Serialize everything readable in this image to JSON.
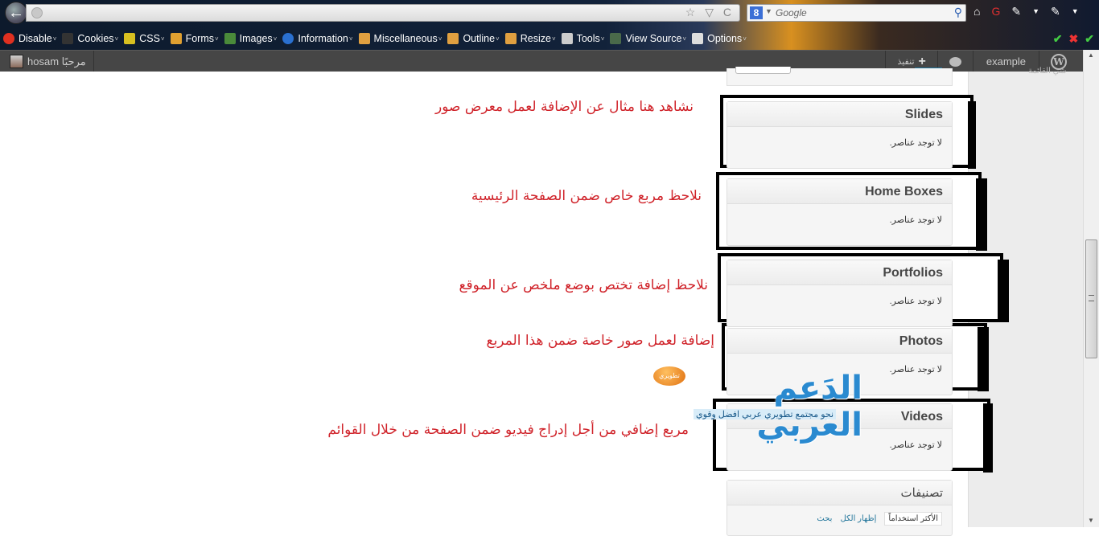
{
  "browser": {
    "back_label": "←",
    "search_engine_icon": "8",
    "search_placeholder": "Google",
    "url_controls": "☆ ▽ C",
    "nav_icons": [
      "home-icon",
      "addon-icon",
      "tools-icon",
      "dropdown-icon",
      "extension-icon",
      "dropdown-icon"
    ]
  },
  "devtoolbar": {
    "items": [
      {
        "label": "Disable",
        "icon": "disable-icon",
        "color": "#e03020"
      },
      {
        "label": "Cookies",
        "icon": "cookies-icon",
        "color": "#333333"
      },
      {
        "label": "CSS",
        "icon": "css-icon",
        "color": "#d8c020"
      },
      {
        "label": "Forms",
        "icon": "forms-icon",
        "color": "#e0a030"
      },
      {
        "label": "Images",
        "icon": "images-icon",
        "color": "#4a8a3a"
      },
      {
        "label": "Information",
        "icon": "information-icon",
        "color": "#2a70d0"
      },
      {
        "label": "Miscellaneous",
        "icon": "miscellaneous-icon",
        "color": "#e0a040"
      },
      {
        "label": "Outline",
        "icon": "outline-icon",
        "color": "#e0a040"
      },
      {
        "label": "Resize",
        "icon": "resize-icon",
        "color": "#e0a040"
      },
      {
        "label": "Tools",
        "icon": "tools-icon",
        "color": "#cccccc"
      },
      {
        "label": "View Source",
        "icon": "view-source-icon",
        "color": "#4a6a4a"
      },
      {
        "label": "Options",
        "icon": "options-icon",
        "color": "#dddddd"
      }
    ],
    "status": [
      "✔",
      "✖",
      "✔"
    ]
  },
  "adminbar": {
    "greeting": "مرحبًا",
    "username": "hosam",
    "new_label": "تنفيذ",
    "site_name": "example"
  },
  "sidebar": {
    "link": "شي القائمة"
  },
  "boxes": [
    {
      "title": "Slides",
      "empty": "لا توجد عناصر."
    },
    {
      "title": "Home Boxes",
      "empty": "لا توجد عناصر."
    },
    {
      "title": "Portfolios",
      "empty": "لا توجد عناصر."
    },
    {
      "title": "Photos",
      "empty": "لا توجد عناصر."
    },
    {
      "title": "Videos",
      "empty": "لا توجد عناصر."
    }
  ],
  "annotations": [
    "نشاهد هنا مثال عن الإضافة لعمل معرض صور",
    "نلاحظ مربع خاص ضمن الصفحة الرئيسية",
    "نلاحظ إضافة تختص بوضع ملخص عن الموقع",
    "إضافة لعمل صور خاصة ضمن هذا المربع",
    "مربع إضافي من أجل إدراج فيديو ضمن الصفحة من خلال القوائم"
  ],
  "categories": {
    "title": "تصنيفات",
    "tabs": [
      "الأكثر استخداماً",
      "إظهار الكل",
      "بحث"
    ]
  },
  "watermark": {
    "badge": "تطويري",
    "title": "الدَعم العَربي",
    "tagline": "نحو مجتمع تطويري عربي افضل وقوي"
  },
  "colors": {
    "annotation": "#d0232a",
    "adminbar": "#464646",
    "link": "#21759b"
  }
}
